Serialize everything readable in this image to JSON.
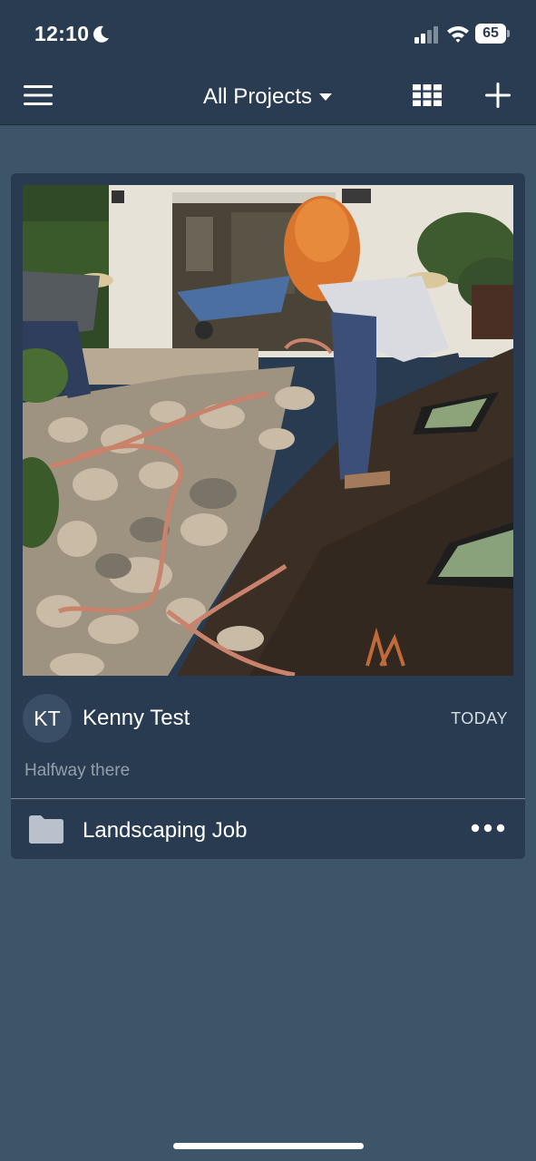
{
  "status_bar": {
    "time": "12:10",
    "battery": "65"
  },
  "nav": {
    "title": "All Projects",
    "menu_icon": "hamburger-menu-icon",
    "grid_icon": "grid-view-icon",
    "add_icon": "plus-icon"
  },
  "feed": {
    "post": {
      "photo_alt": "",
      "avatar_initials": "KT",
      "author": "Kenny Test",
      "date": "TODAY",
      "caption": "Halfway there",
      "project_name": "Landscaping Job",
      "folder_icon": "folder-icon",
      "more_icon": "more-horizontal-icon"
    }
  },
  "colors": {
    "background": "#3d5568",
    "topbar": "#2a3c52",
    "card": "#283b50",
    "muted_text": "#93a0ad"
  }
}
